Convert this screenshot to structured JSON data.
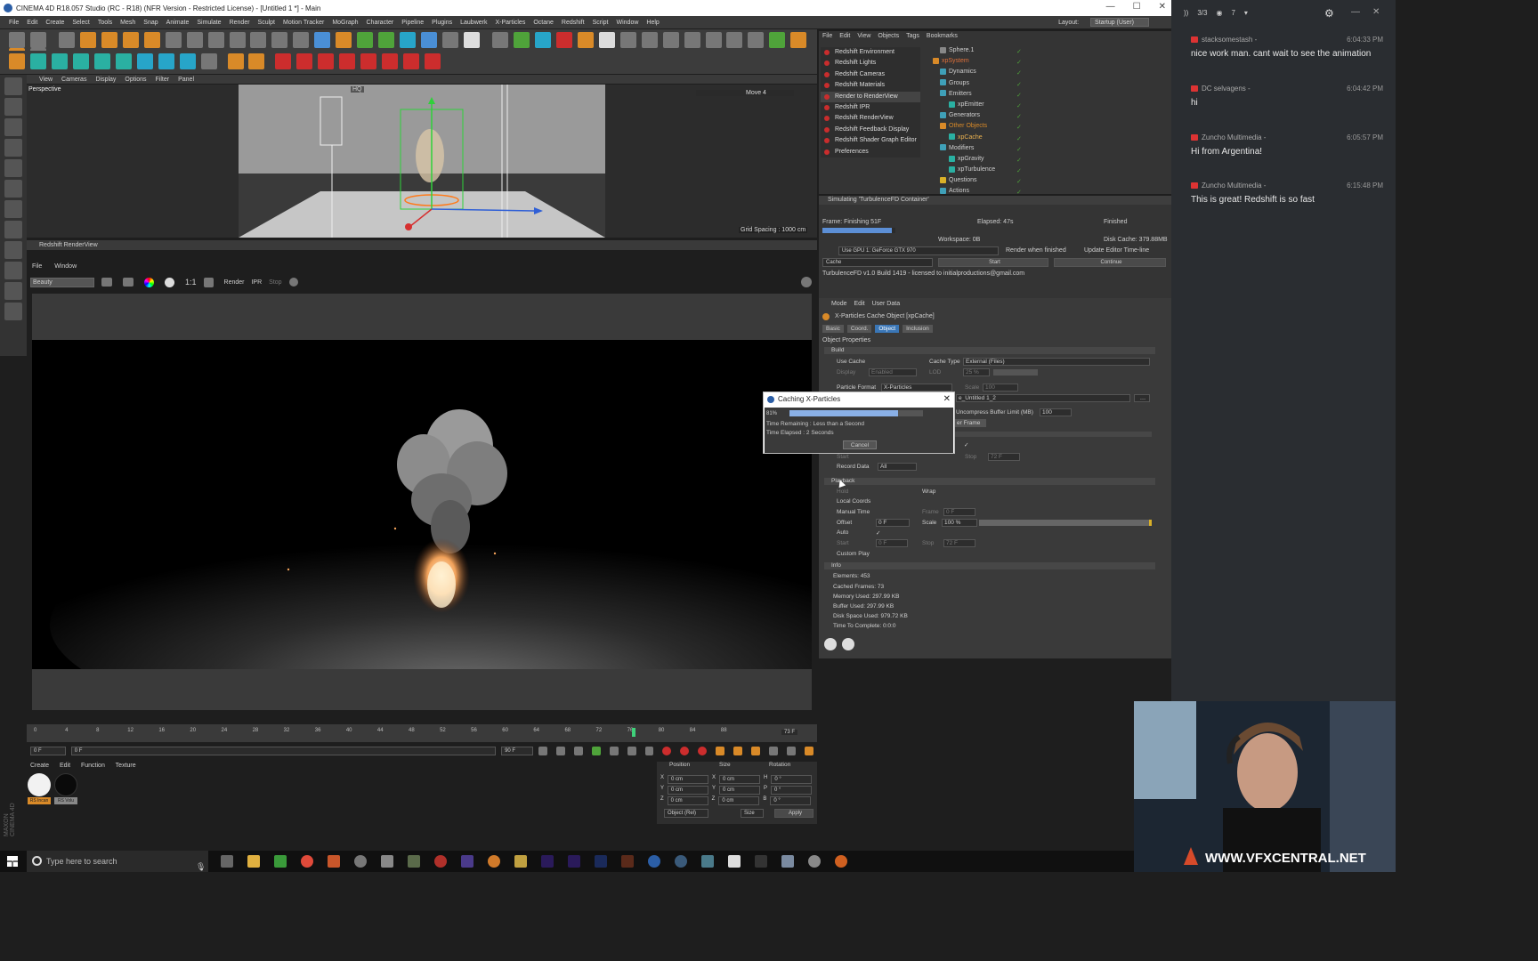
{
  "window": {
    "title": "CINEMA 4D R18.057 Studio (RC - R18) (NFR Version - Restricted License) - [Untitled 1 *] - Main"
  },
  "menubar": {
    "items": [
      "File",
      "Edit",
      "Create",
      "Select",
      "Tools",
      "Mesh",
      "Snap",
      "Animate",
      "Simulate",
      "Render",
      "Sculpt",
      "Motion Tracker",
      "MoGraph",
      "Character",
      "Pipeline",
      "Plugins",
      "Laubwerk",
      "X-Particles",
      "Octane",
      "Redshift",
      "Script",
      "Window",
      "Help"
    ],
    "layout_label": "Layout:",
    "layout_value": "Startup (User)"
  },
  "viewport": {
    "menu": [
      "View",
      "Cameras",
      "Display",
      "Options",
      "Filter",
      "Panel"
    ],
    "name": "Perspective",
    "hud_move": "Move 4",
    "hud_hq": "HQ",
    "grid_spacing": "Grid Spacing : 1000 cm"
  },
  "renderview": {
    "title": "Redshift RenderView",
    "menu": [
      "File",
      "Window"
    ],
    "aov": "Beauty",
    "ratio": "1:1",
    "render": "Render",
    "ipr": "IPR",
    "stop": "Stop"
  },
  "timeline": {
    "ticks": [
      "0",
      "4",
      "8",
      "12",
      "16",
      "20",
      "24",
      "28",
      "32",
      "36",
      "40",
      "44",
      "48",
      "52",
      "56",
      "60",
      "64",
      "68",
      "72",
      "76",
      "80",
      "84",
      "88"
    ],
    "current_frame": "73",
    "end_display": "73 F",
    "start_field": "0 F",
    "min_field": "0 F",
    "max_field": "90 F",
    "right_field": "90 F",
    "playhead_fraction": 0.811
  },
  "materials": {
    "menu": [
      "Create",
      "Edit",
      "Function",
      "Texture"
    ],
    "items": [
      {
        "label": "RS Incan",
        "color": "#f2f2f2"
      },
      {
        "label": "RS Volu",
        "color": "#0a0a0a"
      }
    ]
  },
  "coords": {
    "headers": [
      "Position",
      "Size",
      "Rotation"
    ],
    "rows": [
      {
        "a": "X",
        "pos": "0 cm",
        "b": "X",
        "size": "0 cm",
        "c": "H",
        "rot": "0 °"
      },
      {
        "a": "Y",
        "pos": "0 cm",
        "b": "Y",
        "size": "0 cm",
        "c": "P",
        "rot": "0 °"
      },
      {
        "a": "Z",
        "pos": "0 cm",
        "b": "Z",
        "size": "0 cm",
        "c": "B",
        "rot": "0 °"
      }
    ],
    "mode": "Object (Rel)",
    "size_mode": "Size",
    "apply": "Apply"
  },
  "object_manager": {
    "menu": [
      "File",
      "Edit",
      "View",
      "Objects",
      "Tags",
      "Bookmarks"
    ],
    "redshift_menu": [
      "Redshift Environment",
      "Redshift Lights",
      "Redshift Cameras",
      "Redshift Materials",
      "Render to RenderView",
      "Redshift IPR",
      "Redshift RenderView",
      "Redshift Feedback Display",
      "Redshift Shader Graph Editor",
      "Preferences"
    ],
    "tree": [
      "Sphere.1",
      "xpSystem",
      "Dynamics",
      "Groups",
      "Emitters",
      "xpEmitter",
      "Generators",
      "Other Objects",
      "xpCache",
      "Modifiers",
      "xpGravity",
      "xpTurbulence",
      "Questions",
      "Actions"
    ]
  },
  "simulate": {
    "title": "Simulating 'TurbulenceFD Container'",
    "frame": "Frame: Finishing 51F",
    "elapsed": "Elapsed: 47s",
    "status": "Finished",
    "disk_cache": "Disk Cache: 379.88MB",
    "workspace": "Workspace: 0B",
    "gpu": "Use GPU 1: GeForce GTX 970",
    "render_when_finished": "Render when finished",
    "update_editor": "Update Editor Time-line",
    "cache": "Cache",
    "start": "Start",
    "continue": "Continue",
    "build": "TurbulenceFD v1.0 Build 1419 - licensed to initialproductions@gmail.com",
    "progress_fraction": 0.95
  },
  "attributes": {
    "menu": [
      "Mode",
      "Edit",
      "User Data"
    ],
    "object_title": "X-Particles Cache Object [xpCache]",
    "tabs": [
      "Basic",
      "Coord.",
      "Object",
      "Inclusion"
    ],
    "active_tab": "Object",
    "object_properties": "Object Properties",
    "build_section": "Build",
    "use_cache": "Use Cache",
    "cache_type_label": "Cache Type",
    "cache_type_value": "External (Files)",
    "display_label": "Display",
    "display_value": "Enabled",
    "lod_label": "LOD",
    "lod_value": "25 %",
    "particle_format_label": "Particle Format",
    "particle_format_value": "X-Particles",
    "scale_label": "Scale",
    "scale_value": "100",
    "cache_file": "e_Untitled 1_2",
    "uncompress_label": "Uncompress Buffer Limit (MB)",
    "uncompress_value": "100",
    "per_frame": "er Frame",
    "start_label": "Start",
    "stop_label": "Stop",
    "stop_value": "72 F",
    "record_data_label": "Record Data",
    "record_data_value": "All",
    "playback_section": "Playback",
    "hold_label": "Hold",
    "wrap_label": "Wrap",
    "local_coords": "Local Coords",
    "manual_time": "Manual Time",
    "frame_label": "Frame",
    "frame_value": "0 F",
    "offset_label": "Offset",
    "offset_value": "0 F",
    "pscale_label": "Scale",
    "pscale_value": "100 %",
    "auto_label": "Auto",
    "pstart_label": "Start",
    "pstart_value": "0 F",
    "pstop_label": "Stop",
    "pstop_value": "72 F",
    "custom_play": "Custom Play",
    "info_section": "Info",
    "info": [
      "Elements: 453",
      "Cached Frames: 73",
      "Memory Used: 297.99 KB",
      "Buffer Used: 297.99 KB",
      "Disk Space Used: 979.72 KB",
      "Time To Complete: 0:0:0"
    ]
  },
  "dialog": {
    "title": "Caching X-Particles",
    "percent": "81%",
    "progress_fraction": 0.81,
    "remaining": "Time Remaining : Less than a Second",
    "elapsed": "Time Elapsed : 2 Seconds",
    "cancel": "Cancel"
  },
  "chat": {
    "viewers": "3/3",
    "eye_count": "7",
    "messages": [
      {
        "user": "stacksomestash -",
        "time": "6:04:33 PM",
        "text": "nice work man. cant wait to see the animation"
      },
      {
        "user": "DC selvagens -",
        "time": "6:04:42 PM",
        "text": "hi"
      },
      {
        "user": "Zuncho Multimedia -",
        "time": "6:05:57 PM",
        "text": "Hi from Argentina!"
      },
      {
        "user": "Zuncho Multimedia -",
        "time": "6:15:48 PM",
        "text": "This is great! Redshift is so fast"
      }
    ]
  },
  "taskbar": {
    "search_placeholder": "Type here to search"
  },
  "watermark": "WWW.VFXCENTRAL.NET",
  "maxon": "MAXON CINEMA 4D"
}
